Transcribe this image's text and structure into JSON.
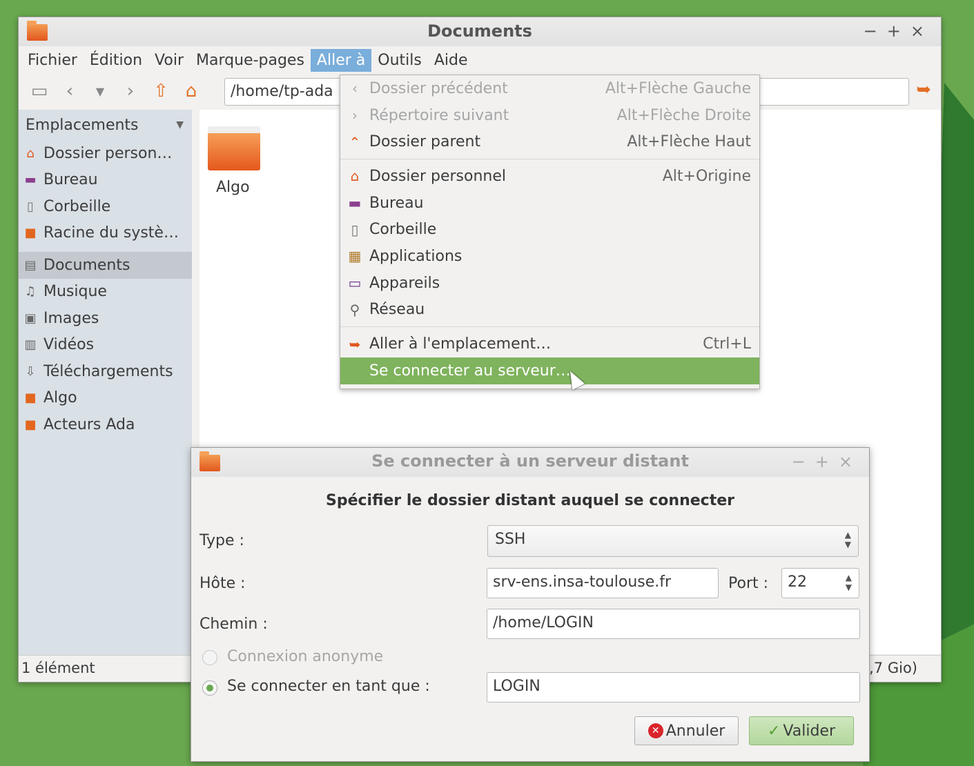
{
  "window": {
    "title": "Documents",
    "controls": [
      "−",
      "+",
      "×"
    ]
  },
  "menubar": [
    "Fichier",
    "Édition",
    "Voir",
    "Marque-pages",
    "Aller à",
    "Outils",
    "Aide"
  ],
  "toolbar": {
    "path": "/home/tp-ada"
  },
  "sidebar": {
    "header": "Emplacements",
    "group1": [
      {
        "label": "Dossier person…",
        "icon": "home-icon"
      },
      {
        "label": "Bureau",
        "icon": "desktop-icon"
      },
      {
        "label": "Corbeille",
        "icon": "trash-icon"
      },
      {
        "label": "Racine du systè…",
        "icon": "folder-icon"
      }
    ],
    "group2": [
      {
        "label": "Documents",
        "icon": "documents-icon"
      },
      {
        "label": "Musique",
        "icon": "music-icon"
      },
      {
        "label": "Images",
        "icon": "images-icon"
      },
      {
        "label": "Vidéos",
        "icon": "video-icon"
      },
      {
        "label": "Téléchargements",
        "icon": "download-icon"
      },
      {
        "label": "Algo",
        "icon": "folder-icon"
      },
      {
        "label": "Acteurs Ada",
        "icon": "folder-icon"
      }
    ]
  },
  "content": {
    "folder_label": "Algo"
  },
  "status": {
    "left": "1 élément",
    "right": ",7 Gio)"
  },
  "goto_menu": {
    "items": [
      {
        "label": "Dossier précédent",
        "accel": "Alt+Flèche Gauche",
        "icon": "back-icon",
        "disabled": true
      },
      {
        "label": "Répertoire suivant",
        "accel": "Alt+Flèche Droite",
        "icon": "forward-icon",
        "disabled": true
      },
      {
        "label": "Dossier parent",
        "accel": "Alt+Flèche Haut",
        "icon": "up-icon"
      },
      {
        "label": "Dossier personnel",
        "accel": "Alt+Origine",
        "icon": "home-icon"
      },
      {
        "label": "Bureau",
        "accel": "",
        "icon": "desktop-icon"
      },
      {
        "label": "Corbeille",
        "accel": "",
        "icon": "trash-icon"
      },
      {
        "label": "Applications",
        "accel": "",
        "icon": "applications-icon"
      },
      {
        "label": "Appareils",
        "accel": "",
        "icon": "devices-icon"
      },
      {
        "label": "Réseau",
        "accel": "",
        "icon": "network-icon"
      },
      {
        "label": "Aller à l'emplacement…",
        "accel": "Ctrl+L",
        "icon": "goto-icon"
      },
      {
        "label": "Se connecter au serveur…",
        "accel": "",
        "icon": "",
        "highlighted": true
      }
    ]
  },
  "dialog": {
    "title": "Se connecter à un serveur distant",
    "heading": "Spécifier le dossier distant auquel se connecter",
    "type_label": "Type :",
    "type_value": "SSH",
    "host_label": "Hôte :",
    "host_value": "srv-ens.insa-toulouse.fr",
    "port_label": "Port :",
    "port_value": "22",
    "path_label": "Chemin :",
    "path_value": "/home/LOGIN",
    "anon_label": "Connexion anonyme",
    "user_label": "Se connecter en tant que :",
    "user_value": "LOGIN",
    "cancel_label": "Annuler",
    "ok_label": "Valider"
  },
  "colors": {
    "desktop": "#6aa84f",
    "menu_highlight": "#7fb35d",
    "menubar_active": "#7aaedb",
    "folder": "#e2571e"
  }
}
